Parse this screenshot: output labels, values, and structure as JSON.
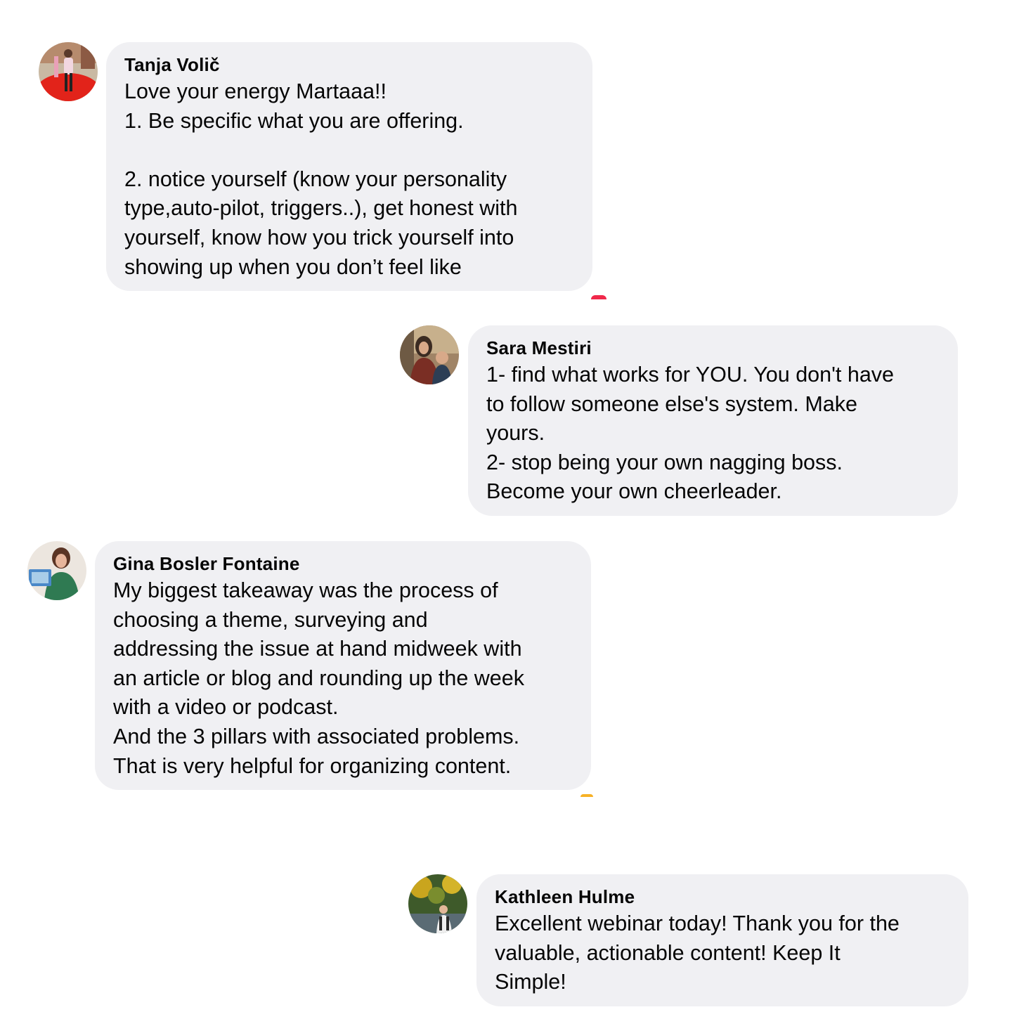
{
  "comments": [
    {
      "author": "Tanja Volič",
      "lines": [
        "Love your energy Martaaa!!",
        "1. Be specific what you are offering.",
        "",
        "2. notice yourself (know your personality",
        "type,auto-pilot, triggers..), get honest with",
        "yourself, know how you trick yourself into",
        "showing up when you don’t feel like"
      ],
      "reaction_color": "#f0284a"
    },
    {
      "author": "Sara Mestiri",
      "lines": [
        "1- find what works for YOU. You don't have",
        "to follow someone else's system. Make",
        "yours.",
        "2- stop being your own nagging boss.",
        "Become your own cheerleader."
      ]
    },
    {
      "author": "Gina Bosler Fontaine",
      "lines": [
        "My biggest takeaway was the process of",
        "choosing a theme, surveying and",
        "addressing the issue at hand midweek with",
        "an article or blog and rounding up the week",
        "with a video or podcast.",
        "And the 3 pillars with associated problems.",
        "That is very helpful for organizing content."
      ],
      "reaction_color": "#f7b125"
    },
    {
      "author": "Kathleen Hulme",
      "lines": [
        "Excellent webinar today!  Thank you for the",
        "valuable, actionable content!  Keep It",
        "Simple!"
      ]
    }
  ],
  "colors": {
    "bubble_bg": "#f0f0f3",
    "text": "#050505"
  },
  "icons": [
    "avatar-tanja-icon",
    "avatar-sara-icon",
    "avatar-gina-icon",
    "avatar-kathleen-icon"
  ]
}
